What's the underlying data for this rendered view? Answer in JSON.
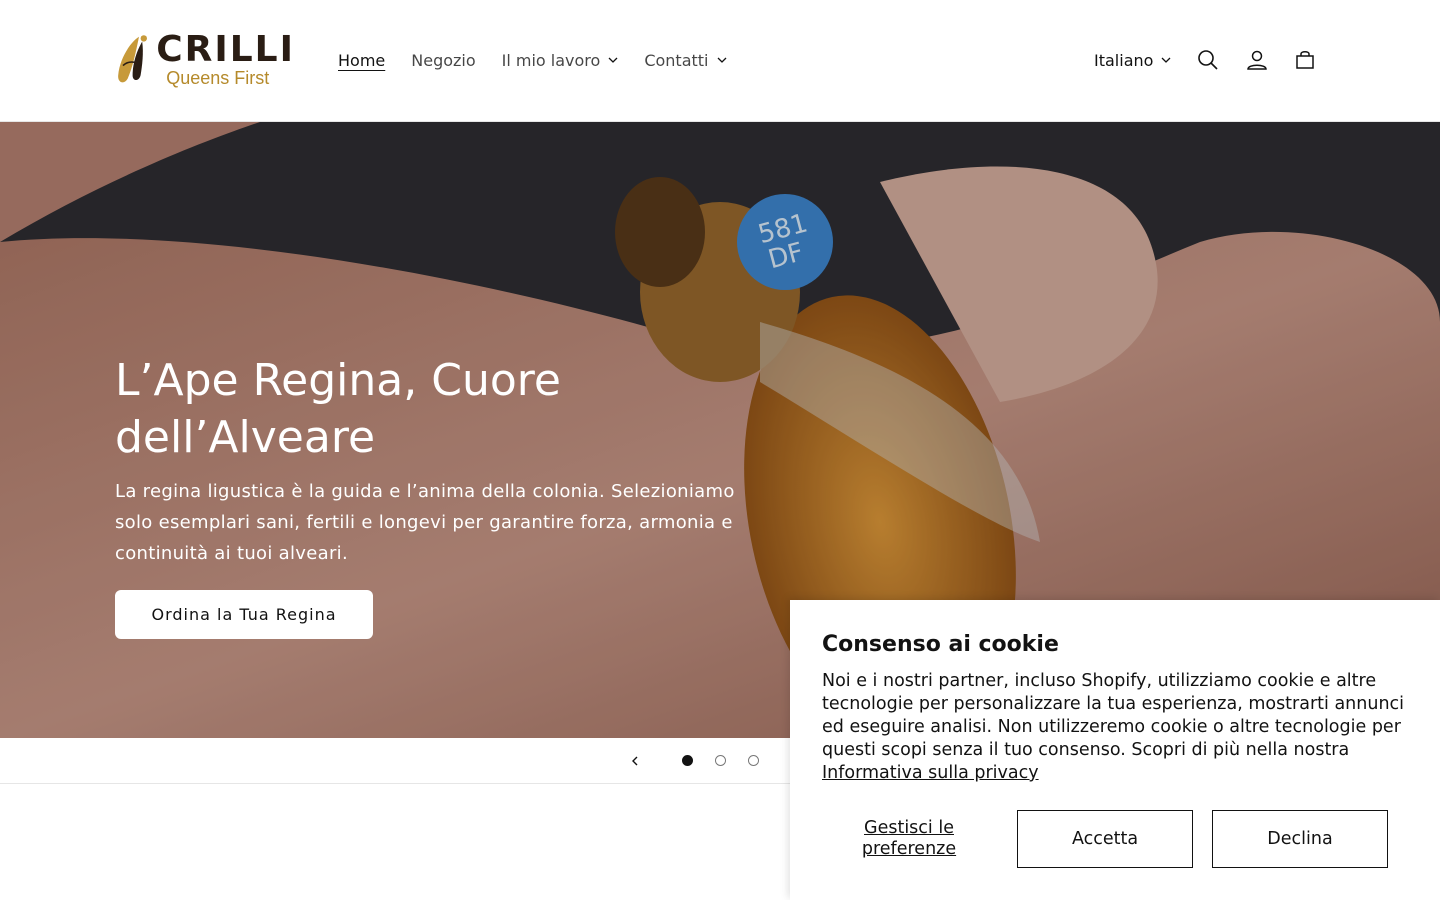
{
  "header": {
    "logo_title": "CRILLI",
    "logo_subtitle": "Queens First",
    "nav": [
      {
        "label": "Home",
        "active": true
      },
      {
        "label": "Negozio"
      },
      {
        "label": "Il mio lavoro",
        "has_dropdown": true
      },
      {
        "label": "Contatti",
        "has_dropdown": true
      }
    ],
    "language": "Italiano",
    "icons": [
      "search-icon",
      "account-icon",
      "cart-icon"
    ]
  },
  "hero": {
    "title": "L’Ape Regina, Cuore dell’Alveare",
    "text": "La regina ligustica è la guida e l’anima della colonia. Selezioniamo solo esemplari sani, fertili e longevi per garantire forza, armonia e continuità ai tuoi alveari.",
    "button": "Ordina la Tua Regina",
    "tag_line1": "581",
    "tag_line2": "DF"
  },
  "slider": {
    "slides": 3,
    "current": 1
  },
  "cookie": {
    "title": "Consenso ai cookie",
    "body": "Noi e i nostri partner, incluso Shopify, utilizziamo cookie e altre tecnologie per personalizzare la tua esperienza, mostrarti annunci ed eseguire analisi. Non utilizzeremo cookie o altre tecnologie per questi scopi senza il tuo consenso. Scopri di più nella nostra",
    "link": "Informativa sulla privacy",
    "manage": "Gestisci le preferenze",
    "accept": "Accetta",
    "decline": "Declina"
  },
  "colors": {
    "brand_dark": "#2a1d14",
    "brand_gold": "#b58a2b",
    "text": "#121212"
  }
}
